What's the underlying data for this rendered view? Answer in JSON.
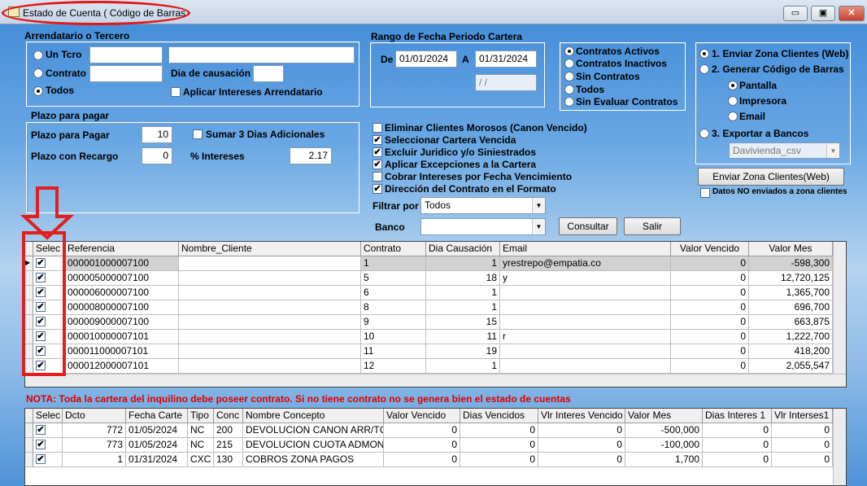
{
  "window": {
    "title": "Estado de Cuenta ( Código de Barras",
    "min": "▭",
    "max": "▣",
    "close": "✕"
  },
  "arrendatario": {
    "legend": "Arrendatario o Tercero",
    "opt_un_tcro": "Un Tcro",
    "opt_contrato": "Contrato",
    "opt_todos": "Todos",
    "dia_causacion": "Dia de causación",
    "aplicar_intereses": "Aplicar Intereses Arrendatario"
  },
  "rango": {
    "legend": "Rango de Fecha Periodo Cartera",
    "de": "De",
    "de_value": "01/01/2024",
    "a": "A",
    "a_value": "01/31/2024",
    "empty_date": "  /  /"
  },
  "contratos": {
    "activos": "Contratos Activos",
    "inactivos": "Contratos Inactivos",
    "sin": "Sin Contratos",
    "todos": "Todos",
    "sin_evaluar": "Sin Evaluar Contratos"
  },
  "envio": {
    "opt1": "1. Enviar Zona Clientes (Web)",
    "opt2": "2. Generar Código de Barras",
    "pantalla": "Pantalla",
    "impresora": "Impresora",
    "email": "Email",
    "opt3": "3. Exportar a Bancos",
    "banco_select": "Davivienda_csv",
    "enviar_button": "Enviar Zona Clientes(Web)",
    "datos_no": "Datos NO enviados a zona clientes"
  },
  "plazo": {
    "legend": "Plazo para pagar",
    "plazo_label": "Plazo para Pagar",
    "plazo_value": "10",
    "sumar": "Sumar 3 Dias Adicionales",
    "recargo_label": "Plazo con Recargo",
    "recargo_value": "0",
    "intereses_label": "% Intereses",
    "intereses_value": "2.17"
  },
  "options": {
    "o1": "Eliminar Clientes Morosos (Canon Vencido)",
    "o2": "Seleccionar Cartera Vencida",
    "o3": "Excluir Juridico y/o Siniestrados",
    "o4": "Aplicar Excepciones a la Cartera",
    "o5": "Cobrar Intereses por Fecha Vencimiento",
    "o6": "Dirección del Contrato en el Formato"
  },
  "filtros": {
    "filtrar_label": "Filtrar por",
    "filtrar_value": "Todos",
    "banco_label": "Banco",
    "consultar": "Consultar",
    "salir": "Salir"
  },
  "grid1": {
    "headers": {
      "selec": "Selec",
      "referencia": "Referencia",
      "nombre": "Nombre_Cliente",
      "contrato": "Contrato",
      "dia": "Dia Causación",
      "email": "Email",
      "vencido": "Valor Vencido",
      "mes": "Valor Mes"
    },
    "rows": [
      {
        "ref": "000001000007100",
        "contrato": "1",
        "dia": "1",
        "email": "yrestrepo@empatia.co",
        "vencido": "0",
        "mes": "-598,300"
      },
      {
        "ref": "000005000007100",
        "contrato": "5",
        "dia": "18",
        "email": "y",
        "vencido": "0",
        "mes": "12,720,125"
      },
      {
        "ref": "000006000007100",
        "contrato": "6",
        "dia": "1",
        "email": "",
        "vencido": "0",
        "mes": "1,365,700"
      },
      {
        "ref": "000008000007100",
        "contrato": "8",
        "dia": "1",
        "email": "",
        "vencido": "0",
        "mes": "696,700"
      },
      {
        "ref": "000009000007100",
        "contrato": "9",
        "dia": "15",
        "email": "",
        "vencido": "0",
        "mes": "663,875"
      },
      {
        "ref": "000010000007101",
        "contrato": "10",
        "dia": "11",
        "email": "r",
        "vencido": "0",
        "mes": "1,222,700"
      },
      {
        "ref": "000011000007101",
        "contrato": "11",
        "dia": "19",
        "email": "",
        "vencido": "0",
        "mes": "418,200"
      },
      {
        "ref": "000012000007101",
        "contrato": "12",
        "dia": "1",
        "email": "",
        "vencido": "0",
        "mes": "2,055,547"
      }
    ]
  },
  "note": "NOTA: Toda la cartera del inquilino debe poseer contrato. Si no tiene contrato no se genera bien el estado de cuentas",
  "grid2": {
    "headers": {
      "selec": "Selec",
      "dcto": "Dcto",
      "fecha": "Fecha Carte",
      "tipo": "Tipo",
      "conc": "Conc",
      "nombre": "Nombre Concepto",
      "vencido": "Valor Vencido",
      "dias": "Dias Vencidos",
      "vlr_int": "Vlr Interes Vencido",
      "mes": "Valor Mes",
      "dias_int": "Dias Interes 1",
      "vlr_int1": "Vlr Interses1"
    },
    "rows": [
      {
        "dcto": "772",
        "fecha": "01/05/2024",
        "tipo": "NC",
        "conc": "200",
        "nombre": "DEVOLUCION CANON ARR/TC",
        "vencido": "0",
        "dias": "0",
        "vlr_int": "0",
        "mes": "-500,000",
        "dias_int": "0",
        "vlr_int1": "0"
      },
      {
        "dcto": "773",
        "fecha": "01/05/2024",
        "tipo": "NC",
        "conc": "215",
        "nombre": "DEVOLUCION CUOTA ADMON",
        "vencido": "0",
        "dias": "0",
        "vlr_int": "0",
        "mes": "-100,000",
        "dias_int": "0",
        "vlr_int1": "0"
      },
      {
        "dcto": "1",
        "fecha": "01/31/2024",
        "tipo": "CXC",
        "conc": "130",
        "nombre": "COBROS ZONA PAGOS",
        "vencido": "0",
        "dias": "0",
        "vlr_int": "0",
        "mes": "1,700",
        "dias_int": "0",
        "vlr_int1": "0"
      }
    ]
  },
  "check_mark": "✔",
  "accent": {
    "red": "#e21e1e",
    "sky": "#6aa8e4"
  }
}
